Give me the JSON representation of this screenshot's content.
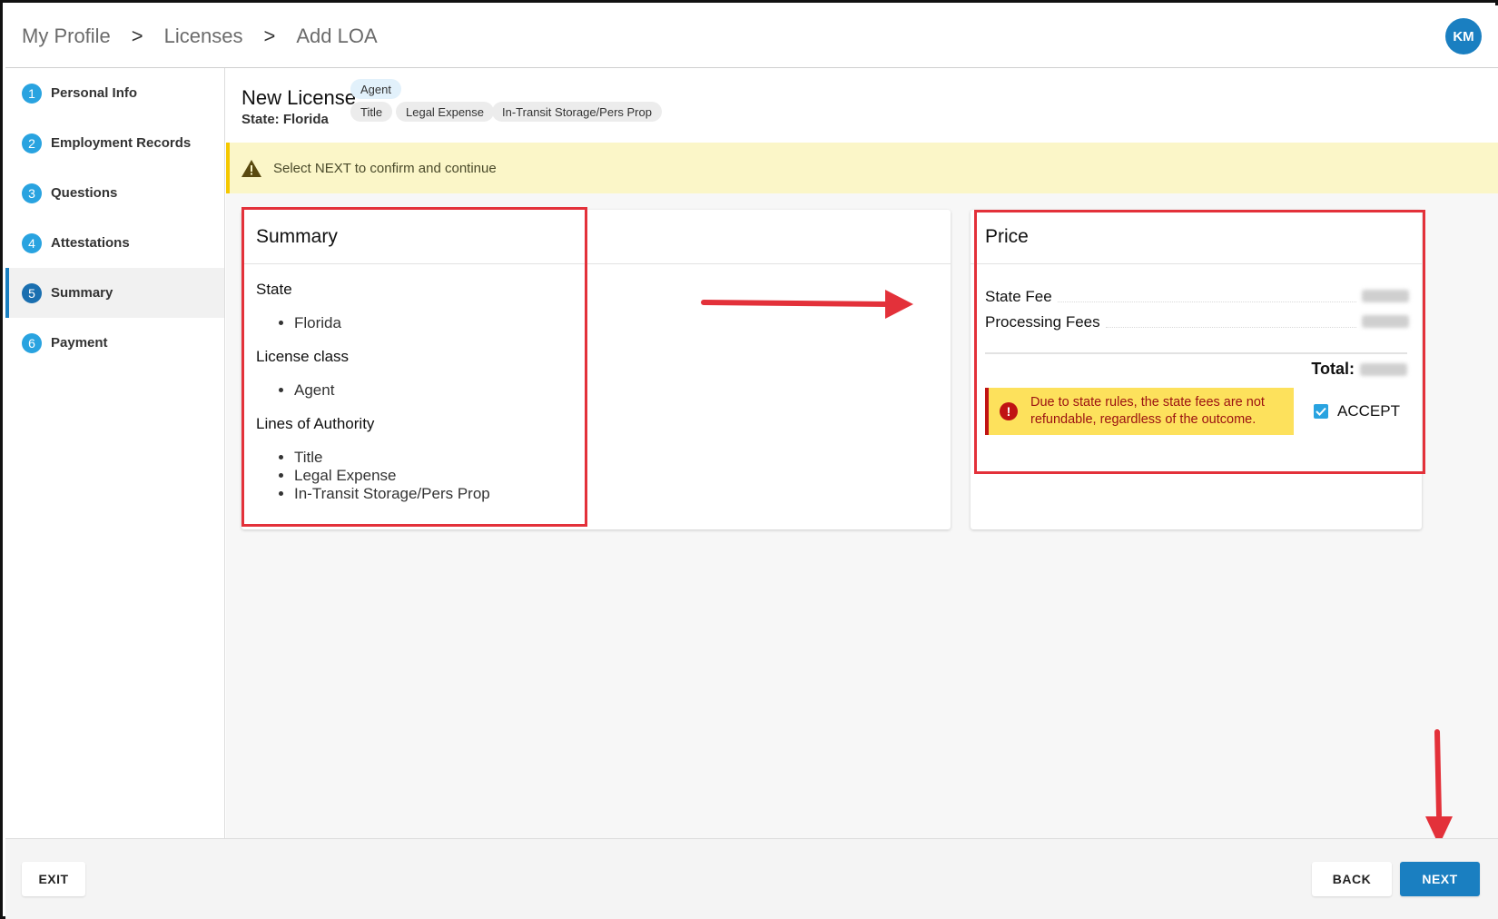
{
  "breadcrumb": {
    "items": [
      "My Profile",
      "Licenses",
      "Add LOA"
    ],
    "separator": ">"
  },
  "user": {
    "initials": "KM"
  },
  "sidebar": {
    "steps": [
      {
        "num": "1",
        "label": "Personal Info"
      },
      {
        "num": "2",
        "label": "Employment Records"
      },
      {
        "num": "3",
        "label": "Questions"
      },
      {
        "num": "4",
        "label": "Attestations"
      },
      {
        "num": "5",
        "label": "Summary"
      },
      {
        "num": "6",
        "label": "Payment"
      }
    ],
    "active_index": 4
  },
  "license": {
    "title": "New License",
    "state_line": "State: Florida",
    "class_chip": "Agent",
    "loa_chips": [
      "Title",
      "Legal Expense",
      "In-Transit Storage/Pers Prop"
    ]
  },
  "banner": {
    "text": "Select NEXT to confirm and continue"
  },
  "summary": {
    "title": "Summary",
    "state_label": "State",
    "state_items": [
      "Florida"
    ],
    "class_label": "License class",
    "class_items": [
      "Agent"
    ],
    "loa_label": "Lines of Authority",
    "loa_items": [
      "Title",
      "Legal Expense",
      "In-Transit Storage/Pers Prop"
    ]
  },
  "price": {
    "title": "Price",
    "state_fee_label": "State Fee",
    "processing_fee_label": "Processing Fees",
    "total_label": "Total:",
    "notice": "Due to state rules, the state fees are not refundable, regardless of the outcome.",
    "accept_label": "ACCEPT",
    "accept_checked": true
  },
  "footer": {
    "exit_label": "EXIT",
    "back_label": "BACK",
    "next_label": "NEXT"
  },
  "colors": {
    "primary": "#1a7fc1",
    "annotation": "#e3313a",
    "banner_bg": "#fbf6c8",
    "notice_bg": "#fde15c"
  }
}
